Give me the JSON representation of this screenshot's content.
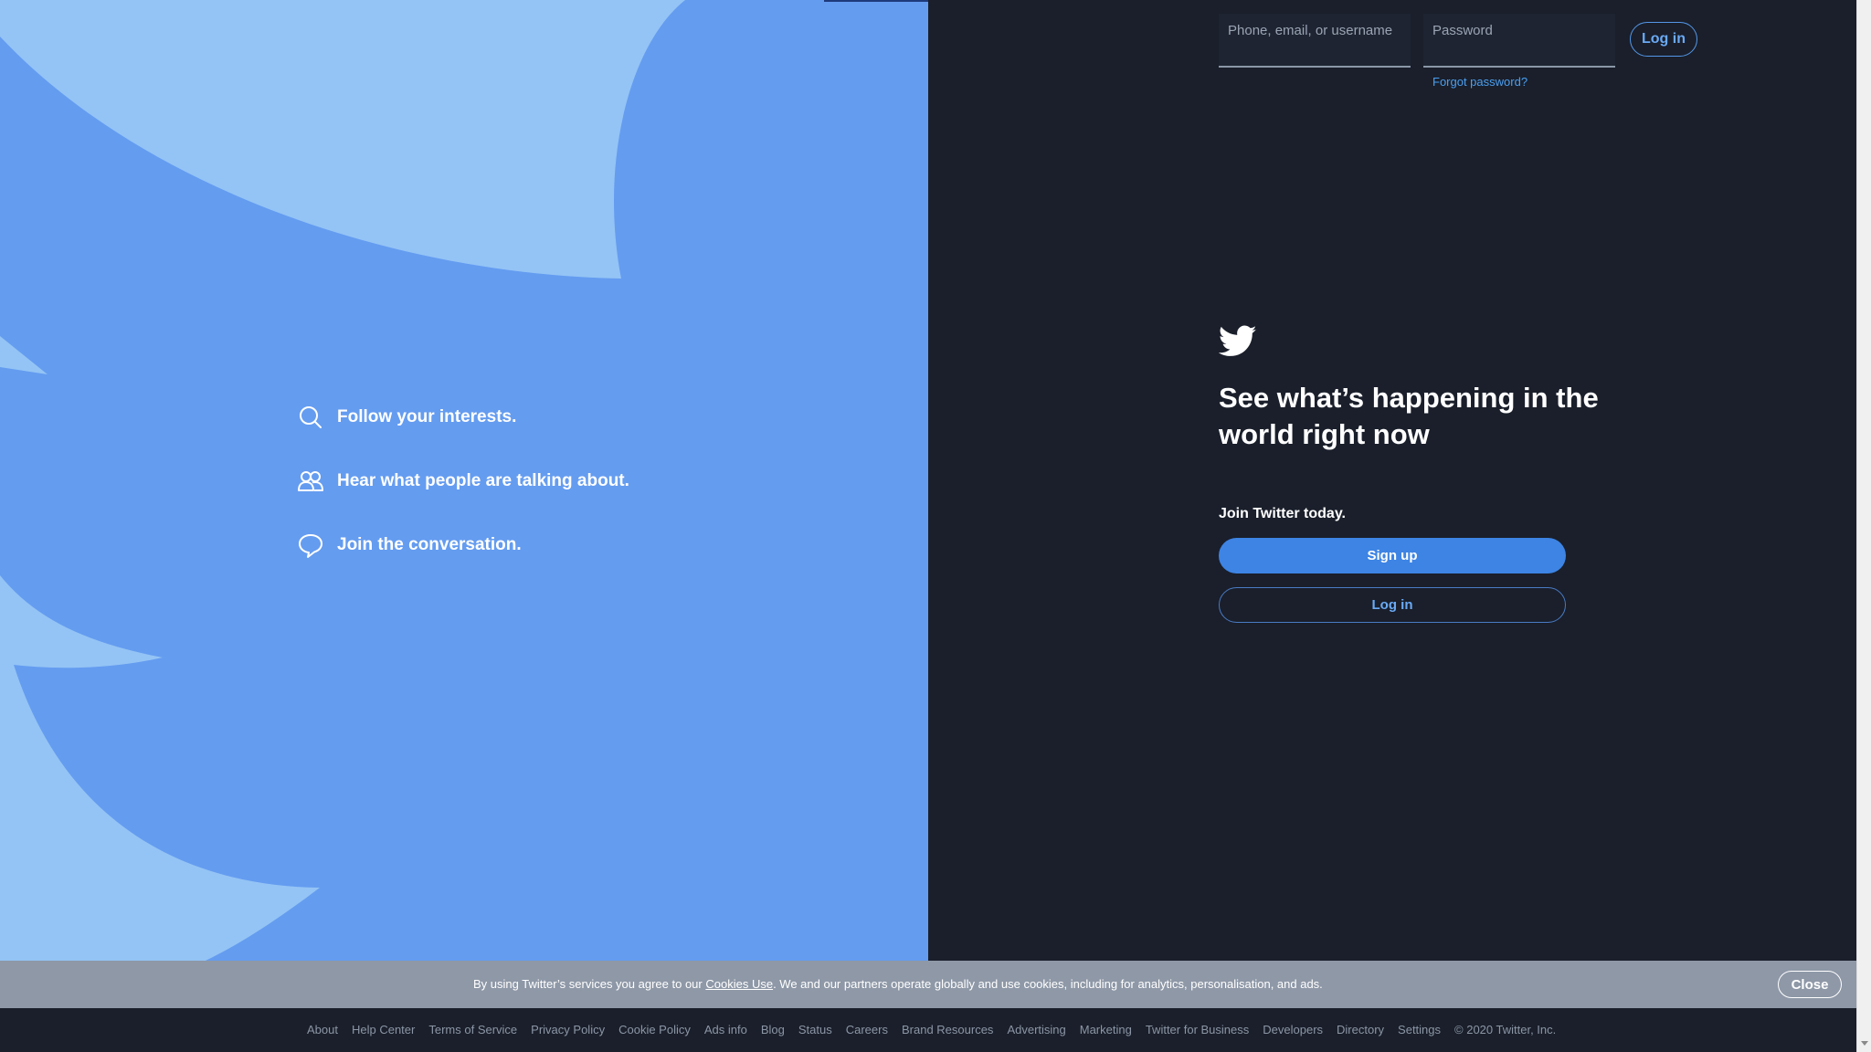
{
  "login": {
    "username_placeholder": "Phone, email, or username",
    "password_placeholder": "Password",
    "forgot_password": "Forgot password?",
    "login_button": "Log in"
  },
  "hero": {
    "features": [
      {
        "icon": "search-icon",
        "text": "Follow your interests."
      },
      {
        "icon": "people-icon",
        "text": "Hear what people are talking about."
      },
      {
        "icon": "speech-bubble-icon",
        "text": "Join the conversation."
      }
    ]
  },
  "main": {
    "logo": "twitter-bird-icon",
    "headline": "See what’s happening in the world right now",
    "join_text": "Join Twitter today.",
    "signup_button": "Sign up",
    "login_button": "Log in"
  },
  "cookie": {
    "text_before": "By using Twitter’s services you agree to our ",
    "link": "Cookies Use",
    "text_after": ". We and our partners operate globally and use cookies, including for analytics, personalisation, and ads.",
    "close_button": "Close"
  },
  "footer": {
    "links": [
      "About",
      "Help Center",
      "Terms of Service",
      "Privacy Policy",
      "Cookie Policy",
      "Ads info",
      "Blog",
      "Status",
      "Careers",
      "Brand Resources",
      "Advertising",
      "Marketing",
      "Twitter for Business",
      "Developers",
      "Directory",
      "Settings"
    ],
    "copyright": "© 2020 Twitter, Inc."
  },
  "colors": {
    "hero_bg": "#649cf0",
    "hero_bird": "#94c4f5",
    "dark_bg": "#1a1f2b",
    "accent": "#3d84e4",
    "cookie_bg": "#8e98a7"
  }
}
